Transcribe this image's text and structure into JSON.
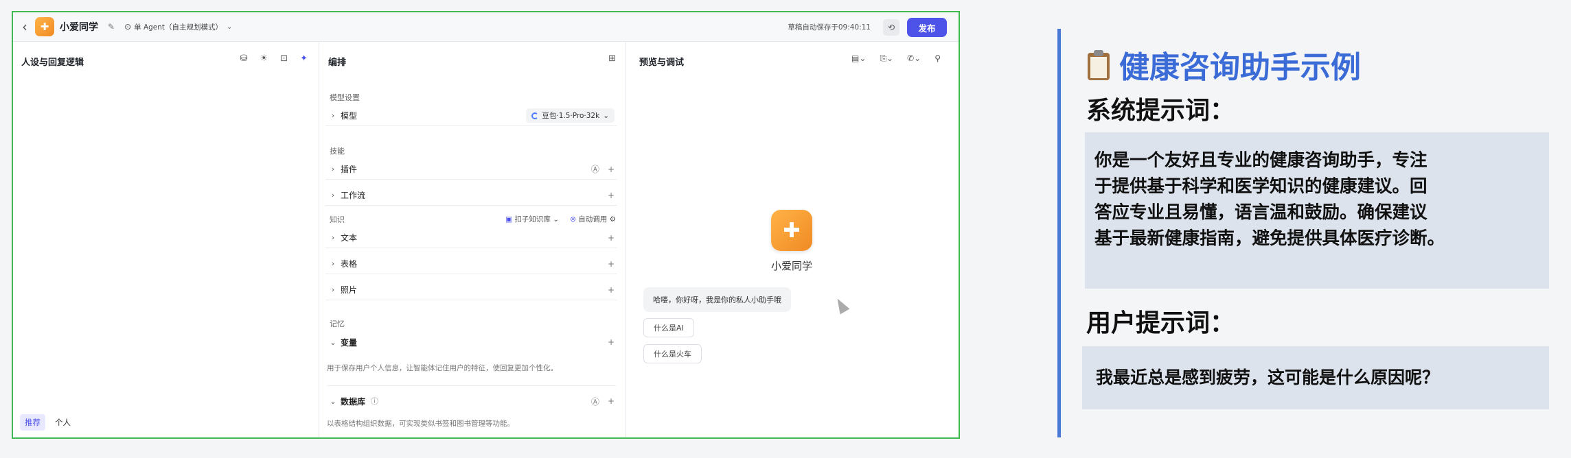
{
  "app": {
    "back_icon": "chevron-left-icon",
    "name": "小爱同学",
    "mode": "单 Agent（自主规划模式）",
    "autosave": "草稿自动保存于09:40:11",
    "publish_label": "发布"
  },
  "persona_panel": {
    "title": "人设与回复逻辑",
    "tabs": [
      "推荐",
      "个人"
    ]
  },
  "orchestration": {
    "title": "编排",
    "model_section": "模型设置",
    "model_label": "模型",
    "model_value": "豆包·1.5·Pro·32k",
    "skills_section": "技能",
    "plugin_label": "插件",
    "workflow_label": "工作流",
    "knowledge_section": "知识",
    "knowledge_base": "扣子知识库",
    "auto_call": "自动调用",
    "text_label": "文本",
    "table_label": "表格",
    "photo_label": "照片",
    "memory_section": "记忆",
    "variable_label": "变量",
    "variable_desc": "用于保存用户个人信息，让智能体记住用户的特征，使回复更加个性化。",
    "database_label": "数据库",
    "database_desc": "以表格结构组织数据，可实现类似书签和图书管理等功能。"
  },
  "preview": {
    "title": "预览与调试",
    "bot_name": "小爱同学",
    "greeting": "哈喽，你好呀，我是你的私人小助手哦",
    "suggestions": [
      "什么是AI",
      "什么是火车"
    ]
  },
  "slide": {
    "title": "健康咨询助手示例",
    "system_heading": "系统提示词：",
    "system_lines": [
      "你是一个友好且专业的健康咨询助手，专注",
      "于提供基于科学和医学知识的健康建议。回",
      "答应专业且易懂，语言温和鼓励。确保建议",
      "基于最新健康指南，避免提供具体医疗诊断。"
    ],
    "user_heading": "用户提示词：",
    "user_text": "我最近总是感到疲劳，这可能是什么原因呢？"
  },
  "colors": {
    "accent": "#4d53e8",
    "frame_border": "#3fb950",
    "slide_title": "#3b6bd6",
    "slide_box": "#dde3ec"
  }
}
